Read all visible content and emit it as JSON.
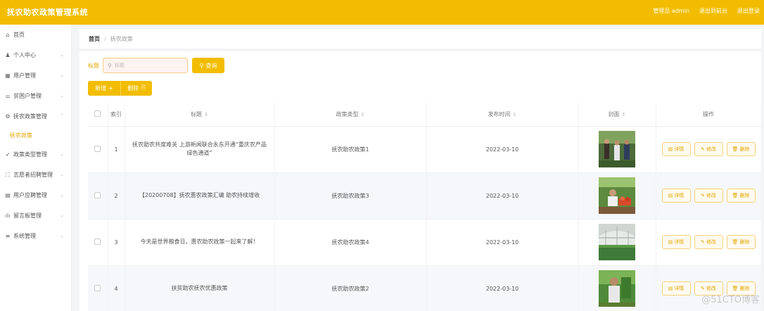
{
  "app": {
    "title": "抚农助农政策管理系统"
  },
  "topbar": {
    "admin_label": "管理员 admin",
    "to_front": "退出到前台",
    "logout": "退出登录"
  },
  "sidebar": {
    "items": [
      {
        "icon": "⌂",
        "label": "首页",
        "chevron": ""
      },
      {
        "icon": "♟",
        "label": "个人中心",
        "chevron": "⌄"
      },
      {
        "icon": "▦",
        "label": "用户管理",
        "chevron": "⌄"
      },
      {
        "icon": "⚌",
        "label": "贫困户管理",
        "chevron": "⌄"
      },
      {
        "icon": "⚙",
        "label": "抚农政策管理",
        "chevron": "⌃"
      }
    ],
    "sub_item": "抚农政策",
    "items2": [
      {
        "icon": "➶",
        "label": "政策类型管理",
        "chevron": "⌄"
      },
      {
        "icon": "⛶",
        "label": "志愿者招聘管理",
        "chevron": "⌄"
      },
      {
        "icon": "▤",
        "label": "用户应聘管理",
        "chevron": "⌄"
      },
      {
        "icon": "ılı",
        "label": "留言板管理",
        "chevron": "⌄"
      },
      {
        "icon": "≡",
        "label": "系统管理",
        "chevron": "⌄"
      }
    ]
  },
  "breadcrumb": {
    "home": "首页",
    "sep": "/",
    "current": "抚农政策"
  },
  "search": {
    "label": "标题",
    "placeholder": "标题",
    "button": "查询"
  },
  "actions": {
    "add": "新增",
    "add_icon": "+",
    "delete": "删除",
    "delete_icon": "🗎"
  },
  "table": {
    "headers": {
      "index": "索引",
      "title": "标题",
      "type": "政策类型",
      "date": "发布时间",
      "cover": "封面",
      "ops": "操作"
    },
    "sort_icon": "⇕",
    "rows": [
      {
        "index": "1",
        "title": "抚农助农共度难关 上游新闻联合永东开通“重庆农产品绿色通道”",
        "type": "抚农助农政策1",
        "date": "2022-03-10"
      },
      {
        "index": "2",
        "title": "【20200708】抚农惠农政策汇编 助农持续增收",
        "type": "抚农助农政策3",
        "date": "2022-03-10"
      },
      {
        "index": "3",
        "title": "今天是世界粮食日，惠农助农政策一起来了解！",
        "type": "抚农助农政策4",
        "date": "2022-03-10"
      },
      {
        "index": "4",
        "title": "扶贫助农抚农优惠政策",
        "type": "抚农助农政策2",
        "date": "2022-03-10"
      }
    ],
    "op_labels": {
      "detail": "详情",
      "edit": "修改",
      "delete": "删除"
    },
    "op_icons": {
      "detail": "▤",
      "edit": "✎",
      "delete": "🗑"
    }
  },
  "watermark": "@51CTO博客",
  "colors": {
    "accent": "#f2bd00"
  }
}
